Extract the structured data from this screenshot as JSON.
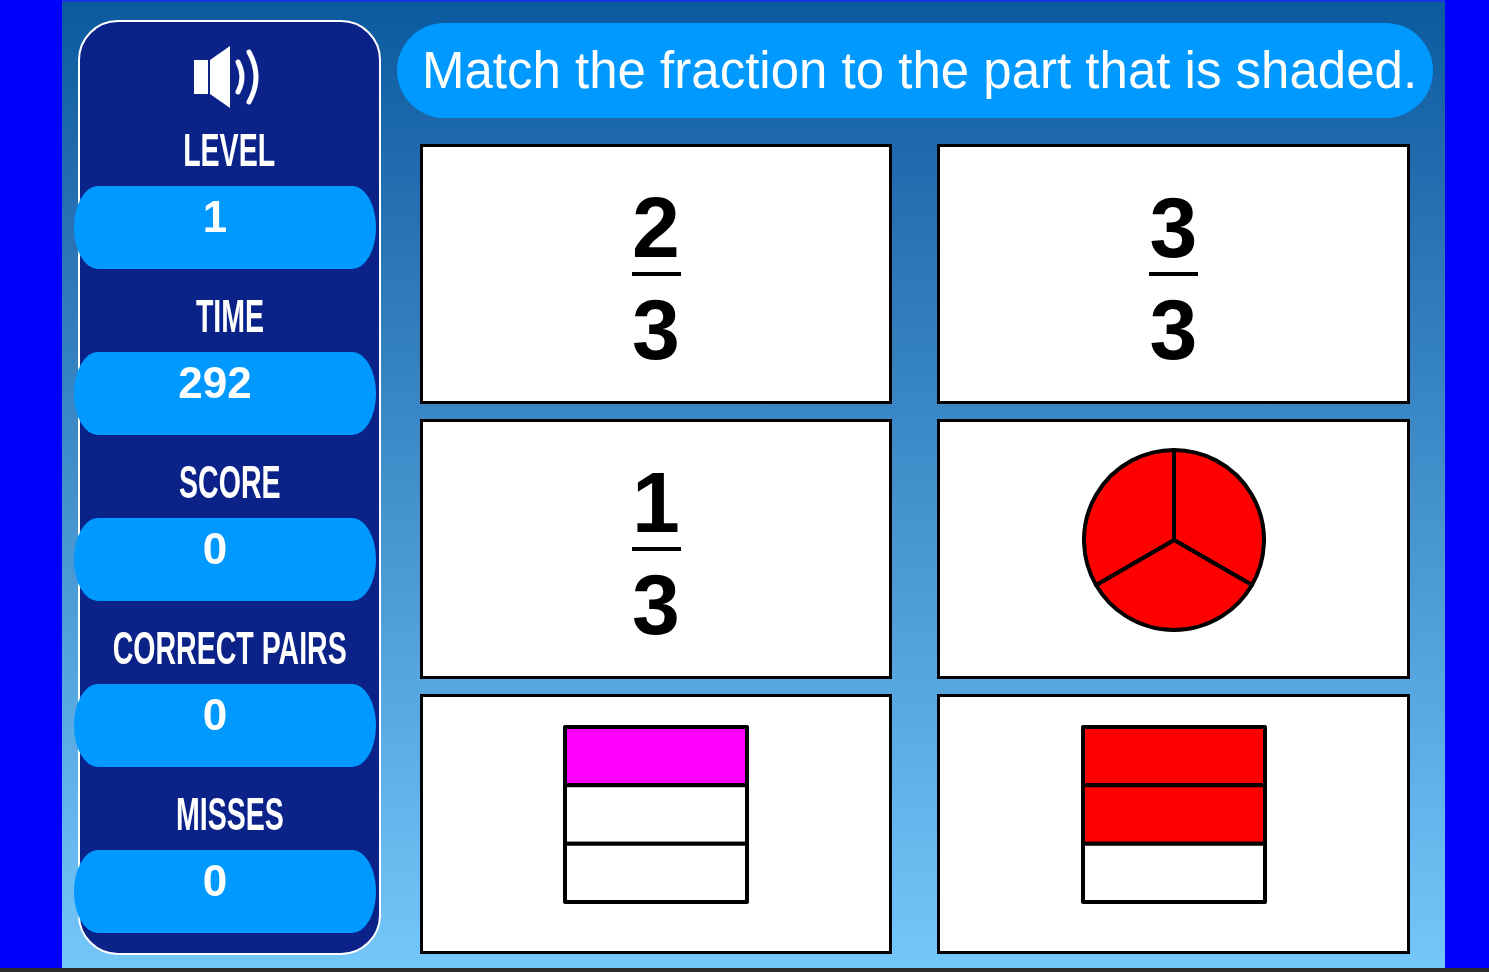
{
  "stats": [
    {
      "label": "LEVEL",
      "value": "1"
    },
    {
      "label": "TIME",
      "value": "292"
    },
    {
      "label": "SCORE",
      "value": "0"
    },
    {
      "label": "CORRECT PAIRS",
      "value": "0"
    },
    {
      "label": "MISSES",
      "value": "0"
    }
  ],
  "instruction": "Match the fraction to the part that is shaded.",
  "cards": [
    {
      "kind": "fraction",
      "numerator": "2",
      "denominator": "3"
    },
    {
      "kind": "fraction",
      "numerator": "3",
      "denominator": "3"
    },
    {
      "kind": "fraction",
      "numerator": "1",
      "denominator": "3"
    },
    {
      "kind": "circle",
      "color": "#ff0000",
      "parts": [
        {
          "shaded": true
        },
        {
          "shaded": true
        },
        {
          "shaded": true
        }
      ]
    },
    {
      "kind": "bars",
      "color": "#ff00ff",
      "parts": [
        {
          "shaded": true
        },
        {
          "shaded": false
        },
        {
          "shaded": false
        }
      ]
    },
    {
      "kind": "bars",
      "color": "#ff0000",
      "parts": [
        {
          "shaded": true
        },
        {
          "shaded": true
        },
        {
          "shaded": false
        }
      ]
    }
  ]
}
